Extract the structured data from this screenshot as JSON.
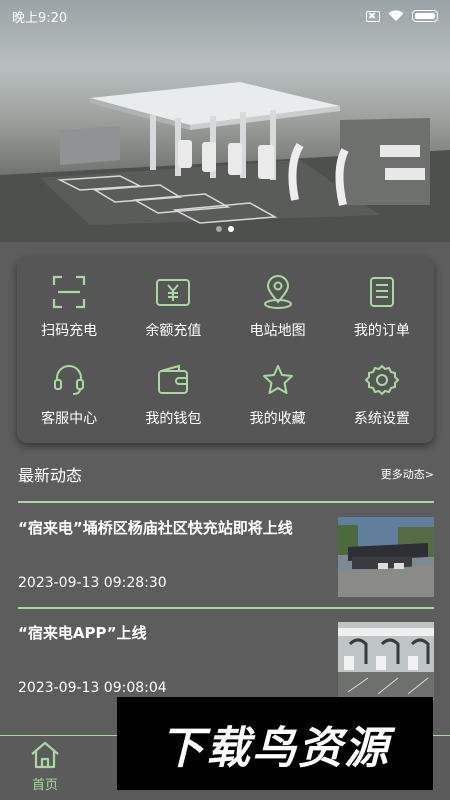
{
  "status_bar": {
    "time": "晚上9:20"
  },
  "banner": {
    "slides": 2,
    "active_slide": 2
  },
  "menu": {
    "items": [
      {
        "label": "扫码充电",
        "icon": "scan-icon"
      },
      {
        "label": "余额充值",
        "icon": "yen-wallet-icon"
      },
      {
        "label": "电站地图",
        "icon": "map-pin-icon"
      },
      {
        "label": "我的订单",
        "icon": "order-list-icon"
      },
      {
        "label": "客服中心",
        "icon": "headset-icon"
      },
      {
        "label": "我的钱包",
        "icon": "wallet-icon"
      },
      {
        "label": "我的收藏",
        "icon": "star-icon"
      },
      {
        "label": "系统设置",
        "icon": "gear-icon"
      }
    ]
  },
  "news": {
    "title": "最新动态",
    "more": "更多动态>",
    "items": [
      {
        "headline": "“宿来电”埇桥区杨庙社区快充站即将上线",
        "date": "2023-09-13 09:28:30"
      },
      {
        "headline": "“宿来电APP”上线",
        "date": "2023-09-13 09:08:04"
      }
    ]
  },
  "bottom_nav": {
    "home_label": "首页"
  },
  "watermark": {
    "text": "下载鸟资源"
  },
  "colors": {
    "accent": "#a9d9a0",
    "background": "#5d5d5d",
    "card": "#565656"
  }
}
